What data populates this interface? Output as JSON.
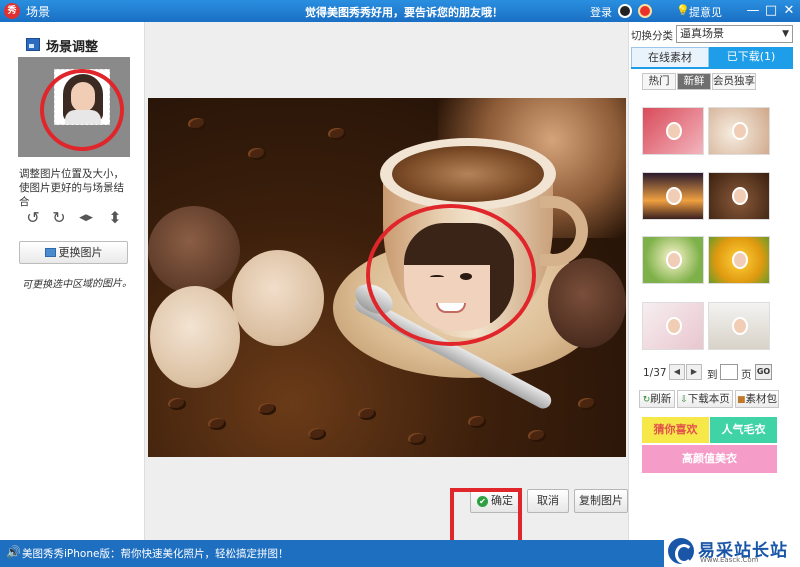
{
  "titlebar": {
    "app_icon": "秀",
    "title": "场景",
    "slogan": "觉得美图秀秀好用，要告诉您的朋友哦！",
    "login": "登录",
    "feedback_icon": "💡",
    "feedback": "提意见",
    "minimize": "—",
    "maximize": "□",
    "close": "✕"
  },
  "left_panel": {
    "title": "场景调整",
    "hint": "调整图片位置及大小，使图片更好的与场景结合",
    "tools": {
      "rotate_left": "↺",
      "rotate_right": "↻",
      "flip_horizontal": "◀▶",
      "flip_vertical": "⬍"
    },
    "replace_button": "更换图片",
    "handwritten_note": "可更换选中区域的图片。"
  },
  "buttons": {
    "confirm": "确定",
    "confirm_icon": "✔",
    "cancel": "取消",
    "copy": "复制图片"
  },
  "right_panel": {
    "category_label": "切换分类",
    "category_value": "逼真场景",
    "category_chevron": "▼",
    "tabs": {
      "online": "在线素材",
      "downloaded": "已下载(1)"
    },
    "filters": {
      "hot": "热门",
      "new": "新鲜",
      "member": "会员独享"
    },
    "pager": {
      "position": "1/37",
      "prev": "◀",
      "next": "▶",
      "to": "到",
      "page": "页",
      "go": "GO"
    },
    "actions": {
      "refresh_icon": "↻",
      "refresh": "刷新",
      "download_icon": "⇩",
      "download": "下载本页",
      "pack_icon": "■",
      "pack": "素材包"
    },
    "banners": {
      "b1": "猜你喜欢",
      "b2": "人气毛衣",
      "b3": "高颜值美衣"
    }
  },
  "statusbar": {
    "speaker_icon": "🔊",
    "text": "美图秀秀iPhone版：帮你快速美化照片，轻松搞定拼图！"
  },
  "watermark": {
    "text": "易采站长站",
    "sub": "Www.Easck.Com"
  },
  "colors": {
    "titlebar": "#1a6fc4",
    "accent": "#1e9ee8",
    "highlight_ring": "#e0262b"
  }
}
